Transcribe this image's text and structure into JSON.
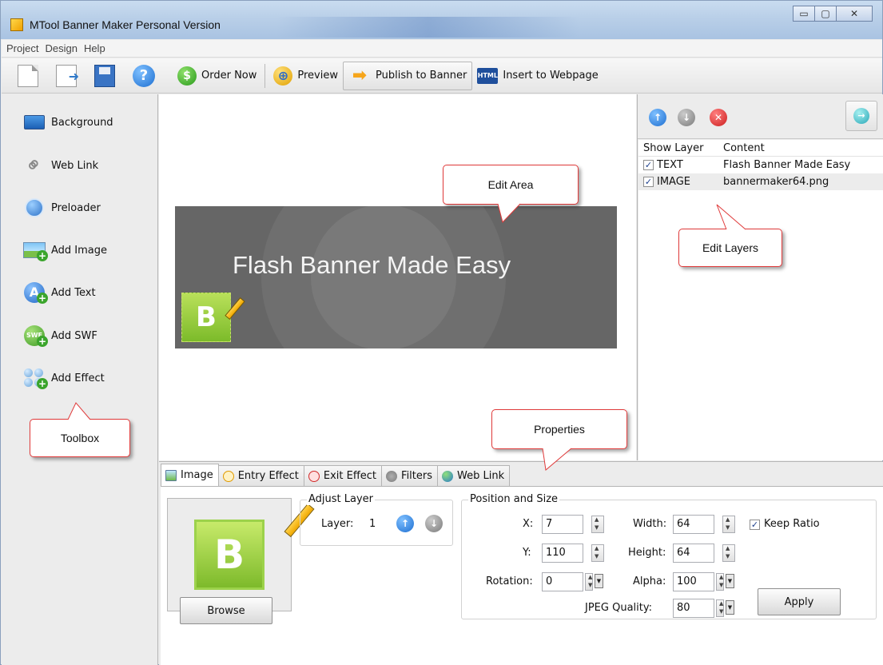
{
  "window": {
    "title": "MTool Banner Maker Personal Version",
    "controls": {
      "minimize": "▭",
      "maximize": "▢",
      "close": "✕"
    }
  },
  "menu": [
    "Project",
    "Design",
    "Help"
  ],
  "toolbar": {
    "icons": [
      "new-document-icon",
      "open-icon",
      "save-icon",
      "help-icon"
    ],
    "help_glyph": "?",
    "order_now": "Order Now",
    "preview": "Preview",
    "publish": "Publish to Banner",
    "insert": "Insert to Webpage",
    "html_badge": "HTML"
  },
  "toolbox": {
    "items": [
      {
        "label": "Background",
        "icon": "monitor-icon"
      },
      {
        "label": "Web Link",
        "icon": "link-icon"
      },
      {
        "label": "Preloader",
        "icon": "preloader-icon"
      },
      {
        "label": "Add Image",
        "icon": "add-image-icon"
      },
      {
        "label": "Add Text",
        "icon": "add-text-icon"
      },
      {
        "label": "Add SWF",
        "icon": "add-swf-icon"
      },
      {
        "label": "Add Effect",
        "icon": "add-effect-icon"
      }
    ],
    "text_glyph": "A",
    "swf_glyph": "SWF",
    "plus_glyph": "+"
  },
  "callouts": {
    "edit_area": "Edit Area",
    "edit_layers": "Edit Layers",
    "toolbox": "Toolbox",
    "properties": "Properties"
  },
  "banner": {
    "text": "Flash Banner Made Easy",
    "logo_letter": "B",
    "background": "#666666"
  },
  "layers": {
    "columns": [
      "Show Layer",
      "Content"
    ],
    "rows": [
      {
        "checked": true,
        "type": "TEXT",
        "content": "Flash Banner Made Easy"
      },
      {
        "checked": true,
        "type": "IMAGE",
        "content": "bannermaker64.png"
      }
    ],
    "check_glyph": "✓",
    "up_glyph": "↑",
    "down_glyph": "↓",
    "delete_glyph": "✕",
    "exit_glyph": "→"
  },
  "properties": {
    "tabs": [
      "Image",
      "Entry Effect",
      "Exit Effect",
      "Filters",
      "Web Link"
    ],
    "browse": "Browse",
    "adjust_layer": {
      "title": "Adjust Layer",
      "label": "Layer:",
      "value": "1"
    },
    "position_size": {
      "title": "Position and Size",
      "x_label": "X:",
      "x": "7",
      "y_label": "Y:",
      "y": "110",
      "rotation_label": "Rotation:",
      "rotation": "0",
      "width_label": "Width:",
      "width": "64",
      "height_label": "Height:",
      "height": "64",
      "alpha_label": "Alpha:",
      "alpha": "100",
      "keep_ratio_label": "Keep Ratio",
      "keep_ratio": true,
      "jpeg_label": "JPEG Quality:",
      "jpeg": "80",
      "apply": "Apply"
    }
  }
}
